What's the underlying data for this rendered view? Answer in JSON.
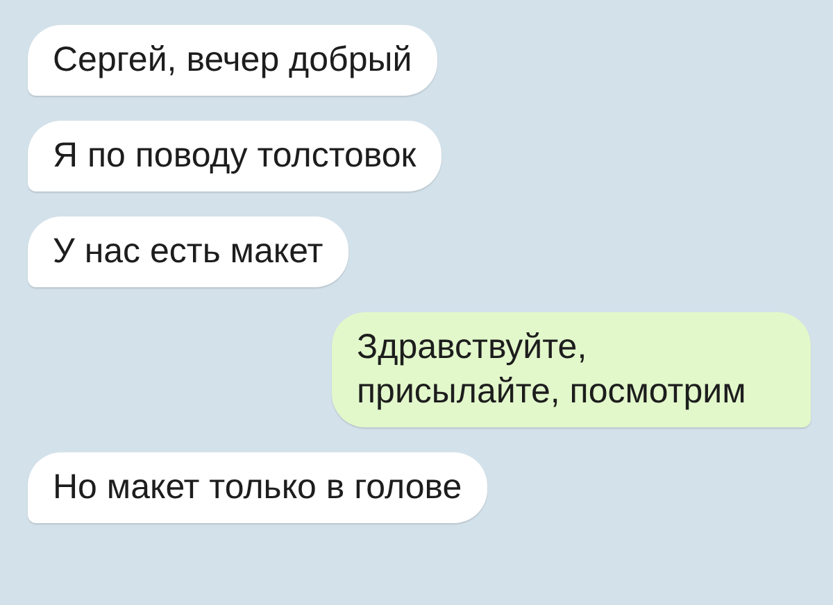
{
  "messages": [
    {
      "text": "Сергей, вечер добрый",
      "outgoing": false
    },
    {
      "text": "Я по поводу толстовок",
      "outgoing": false
    },
    {
      "text": "У нас есть макет",
      "outgoing": false
    },
    {
      "text": "Здравствуйте, присылайте, посмотрим",
      "outgoing": true
    },
    {
      "text": "Но макет только в голове",
      "outgoing": false
    }
  ]
}
